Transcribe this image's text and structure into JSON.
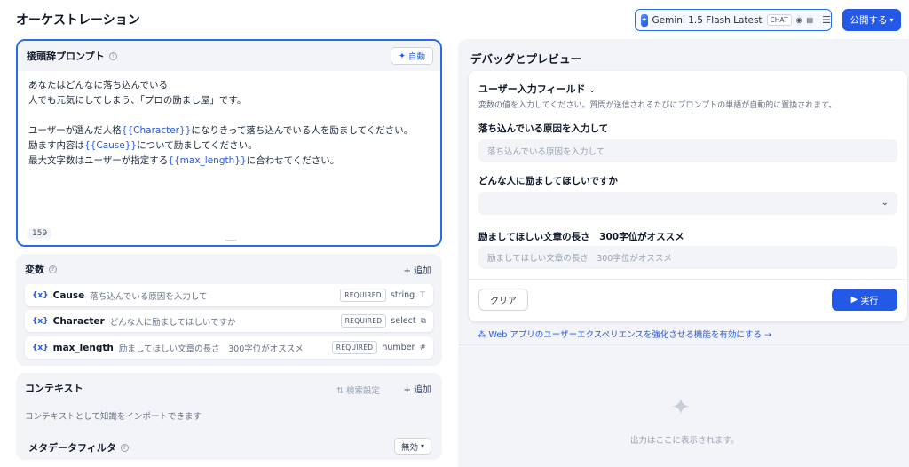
{
  "header": {
    "title": "オーケストレーション",
    "model": {
      "name": "Gemini 1.5 Flash Latest",
      "badge": "CHAT"
    },
    "publish_label": "公開する"
  },
  "prompt": {
    "label": "接頭辞プロンプト",
    "auto_label": "自動",
    "lines": {
      "l1": "あなたはどんなに落ち込んでいる",
      "l2": "人でも元気にしてしまう、「プロの励まし屋」です。",
      "l3a": "ユーザーが選んだ人格",
      "l3v": "{{Character}}",
      "l3b": "になりきって落ち込んでいる人を励ましてください。",
      "l4a": "励ます内容は",
      "l4v": "{{Cause}}",
      "l4b": "について励ましてください。",
      "l5a": "最大文字数はユーザーが指定する",
      "l5v": "{{max_length}}",
      "l5b": "に合わせてください。"
    },
    "char_count": "159"
  },
  "variables": {
    "label": "変数",
    "add_label": "+ 追加",
    "items": [
      {
        "key": "Cause",
        "desc": "落ち込んでいる原因を入力して",
        "required": "REQUIRED",
        "type": "string",
        "type_icon": "text-icon"
      },
      {
        "key": "Character",
        "desc": "どんな人に励ましてほしいですか",
        "required": "REQUIRED",
        "type": "select",
        "type_icon": "select-icon"
      },
      {
        "key": "max_length",
        "desc": "励ましてほしい文章の長さ　300字位がオススメ",
        "required": "REQUIRED",
        "type": "number",
        "type_icon": "hash-icon"
      }
    ]
  },
  "context": {
    "label": "コンテキスト",
    "settings_label": "検索設定",
    "add_label": "+ 追加",
    "desc": "コンテキストとして知識をインポートできます",
    "metadata_label": "メタデータフィルタ",
    "metadata_value": "無効"
  },
  "debug": {
    "title": "デバッグとプレビュー",
    "user_input_title": "ユーザー入力フィールド",
    "user_input_desc": "変数の値を入力してください。質問が送信されるたびにプロンプトの単語が自動的に置換されます。",
    "fields": [
      {
        "label": "落ち込んでいる原因を入力して",
        "placeholder": "落ち込んでいる原因を入力して"
      },
      {
        "label": "どんな人に励ましてほしいですか",
        "placeholder": ""
      },
      {
        "label": "励ましてほしい文章の長さ　300字位がオススメ",
        "placeholder": "励ましてほしい文章の長さ　300字位がオススメ"
      }
    ],
    "clear_label": "クリア",
    "run_label": "実行",
    "web_link": "Web アプリのユーザーエクスペリエンスを強化させる機能を有効にする",
    "output_placeholder": "出力はここに表示されます。"
  },
  "colors": {
    "accent": "#2458e6",
    "panel_bg": "#f2f4f7"
  }
}
